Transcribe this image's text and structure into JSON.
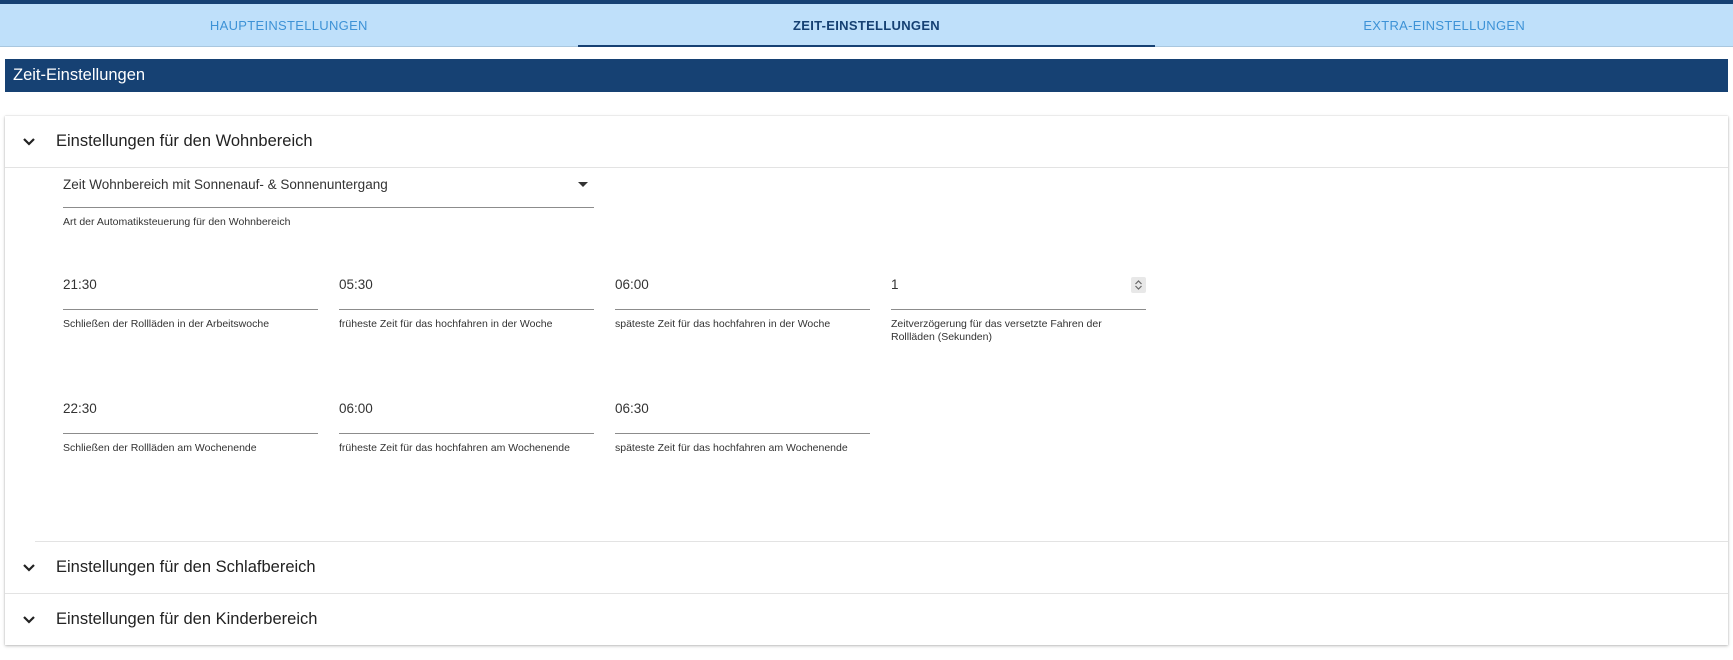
{
  "tabs": [
    {
      "label": "HAUPTEINSTELLUNGEN",
      "active": false
    },
    {
      "label": "ZEIT-EINSTELLUNGEN",
      "active": true
    },
    {
      "label": "EXTRA-EINSTELLUNGEN",
      "active": false
    }
  ],
  "section": {
    "title": "Zeit-Einstellungen"
  },
  "accordions": [
    {
      "title": "Einstellungen für den Wohnbereich",
      "expanded": true
    },
    {
      "title": "Einstellungen für den Schlafbereich",
      "expanded": false
    },
    {
      "title": "Einstellungen für den Kinderbereich",
      "expanded": false
    }
  ],
  "wohnbereich": {
    "mode": {
      "value": "Zeit Wohnbereich mit Sonnenauf- & Sonnenuntergang",
      "help": "Art der Automatiksteuerung für den Wohnbereich"
    },
    "fields": [
      {
        "value": "21:30",
        "help": "Schließen der Rollläden in der Arbeitswoche"
      },
      {
        "value": "05:30",
        "help": "früheste Zeit für das hochfahren in der Woche"
      },
      {
        "value": "06:00",
        "help": "späteste Zeit für das hochfahren in der Woche"
      },
      {
        "value": "1",
        "help": "Zeitverzögerung für das versetzte Fahren der Rollläden (Sekunden)"
      },
      {
        "value": "22:30",
        "help": "Schließen der Rollläden am Wochenende"
      },
      {
        "value": "06:00",
        "help": "früheste Zeit für das hochfahren am Wochenende"
      },
      {
        "value": "06:30",
        "help": "späteste Zeit für das hochfahren am Wochenende"
      }
    ]
  },
  "icons": {
    "chevron": "chevron-down-icon",
    "select": "caret-down-icon",
    "spinner": "spinner-arrows-icon"
  },
  "colors": {
    "primary": "#164173",
    "tab_bg": "#bfe0fa",
    "tab_inactive": "#3d92d6"
  }
}
